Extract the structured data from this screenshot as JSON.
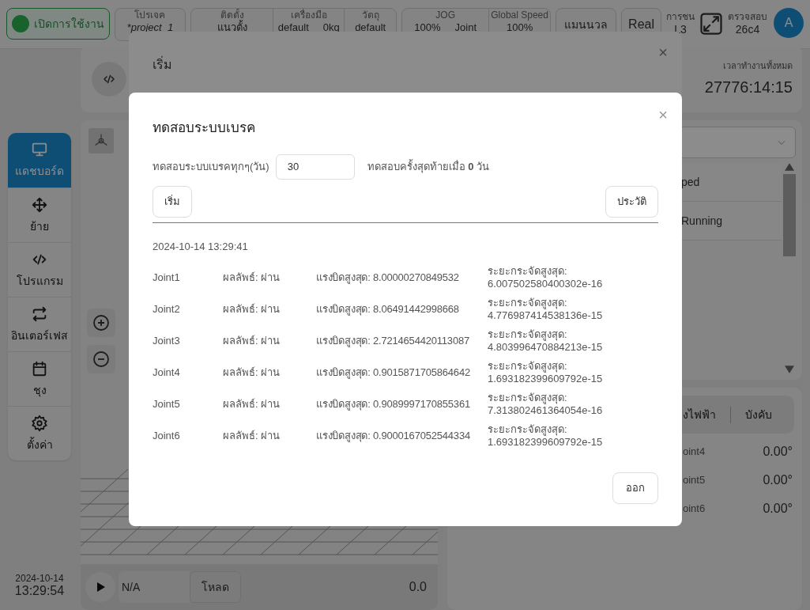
{
  "top_bar": {
    "status_button": {
      "label": "เปิดการใช้งาน",
      "on": true
    },
    "groups": [
      [
        {
          "label": "โปรเจค",
          "values": [
            "*project_1"
          ]
        }
      ],
      [
        {
          "label": "ติดตั้ง",
          "values": [
            "แนวตั้ง"
          ]
        },
        {
          "label": "เครื่องมือ",
          "values": [
            "default",
            "0kg"
          ]
        },
        {
          "label": "วัตถุ",
          "values": [
            "default"
          ]
        }
      ],
      [
        {
          "label": "JOG",
          "values": [
            "100%",
            "Joint"
          ]
        },
        {
          "label": "Global Speed",
          "values": [
            "100%"
          ]
        }
      ]
    ],
    "mode_button": "แมนนวล",
    "real_button": "Real",
    "collision": {
      "label": "การชน",
      "value": "L3"
    },
    "inspect": {
      "label": "ตรวจสอบ",
      "value": "26c4"
    },
    "avatar": "A"
  },
  "sidebar": {
    "items": [
      {
        "kind": "monitor",
        "label": "แดชบอร์ด",
        "selected": true
      },
      {
        "kind": "move",
        "label": "ย้าย",
        "selected": false
      },
      {
        "kind": "code",
        "label": "โปรแกรม",
        "selected": false
      },
      {
        "kind": "swap",
        "label": "อินเตอร์เฟส",
        "selected": false
      },
      {
        "kind": "calendar",
        "label": "ชุง",
        "selected": false
      },
      {
        "kind": "gear",
        "label": "ตั้งค่า",
        "selected": false
      }
    ],
    "date": "2024-10-14",
    "time": "13:29:54"
  },
  "viewer": {
    "program_field": "N/A",
    "load_button": "โหลด",
    "reading": "0.0"
  },
  "right_panel": {
    "runtime_label": "เวลาทำงานทั้งหมด",
    "runtime": "27776:14:15",
    "list": [
      "ped",
      "Running"
    ],
    "tabs": [
      {
        "label": "งไฟฟ้า",
        "selected": false
      },
      {
        "label": "บังคับ",
        "selected": false
      }
    ],
    "joints": [
      {
        "name": "oint4",
        "value": "0.00°"
      },
      {
        "name": "oint5",
        "value": "0.00°"
      },
      {
        "name": "oint6",
        "value": "0.00°"
      }
    ]
  },
  "back_dialog": {
    "title": "เริ่ม",
    "close": "×"
  },
  "dialog": {
    "title": "ทดสอบระบบเบรค",
    "close": "×",
    "interval_label": "ทดสอบระบบเบรคทุกๆ(วัน)",
    "interval_value": "30",
    "last_test": "ทดสอบครั้งสุดท้ายเมื่อ **0** วัน",
    "start_button": "เริ่ม",
    "history_button": "ประวัติ",
    "timestamp": "2024-10-14 13:29:41",
    "results": [
      {
        "joint": "Joint1",
        "result": "ผลลัพธ์: ผ่าน",
        "torque": "แรงบิดสูงสุด: 8.00000270849532",
        "displacement_label": "ระยะกระจัดสูงสุด:",
        "displacement": "6.007502580400302e-16"
      },
      {
        "joint": "Joint2",
        "result": "ผลลัพธ์: ผ่าน",
        "torque": "แรงบิดสูงสุด: 8.06491442998668",
        "displacement_label": "ระยะกระจัดสูงสุด:",
        "displacement": "4.776987414538136e-15"
      },
      {
        "joint": "Joint3",
        "result": "ผลลัพธ์: ผ่าน",
        "torque": "แรงบิดสูงสุด: 2.7214654420113087",
        "displacement_label": "ระยะกระจัดสูงสุด:",
        "displacement": "4.803996470884213e-15"
      },
      {
        "joint": "Joint4",
        "result": "ผลลัพธ์: ผ่าน",
        "torque": "แรงบิดสูงสุด: 0.9015871705864642",
        "displacement_label": "ระยะกระจัดสูงสุด:",
        "displacement": "1.693182399609792e-15"
      },
      {
        "joint": "Joint5",
        "result": "ผลลัพธ์: ผ่าน",
        "torque": "แรงบิดสูงสุด: 0.9089997170855361",
        "displacement_label": "ระยะกระจัดสูงสุด:",
        "displacement": "7.313802461364054e-16"
      },
      {
        "joint": "Joint6",
        "result": "ผลลัพธ์: ผ่าน",
        "torque": "แรงบิดสูงสุด: 0.9000167052544334",
        "displacement_label": "ระยะกระจัดสูงสุด:",
        "displacement": "1.693182399609792e-15"
      }
    ],
    "exit_button": "ออก"
  }
}
